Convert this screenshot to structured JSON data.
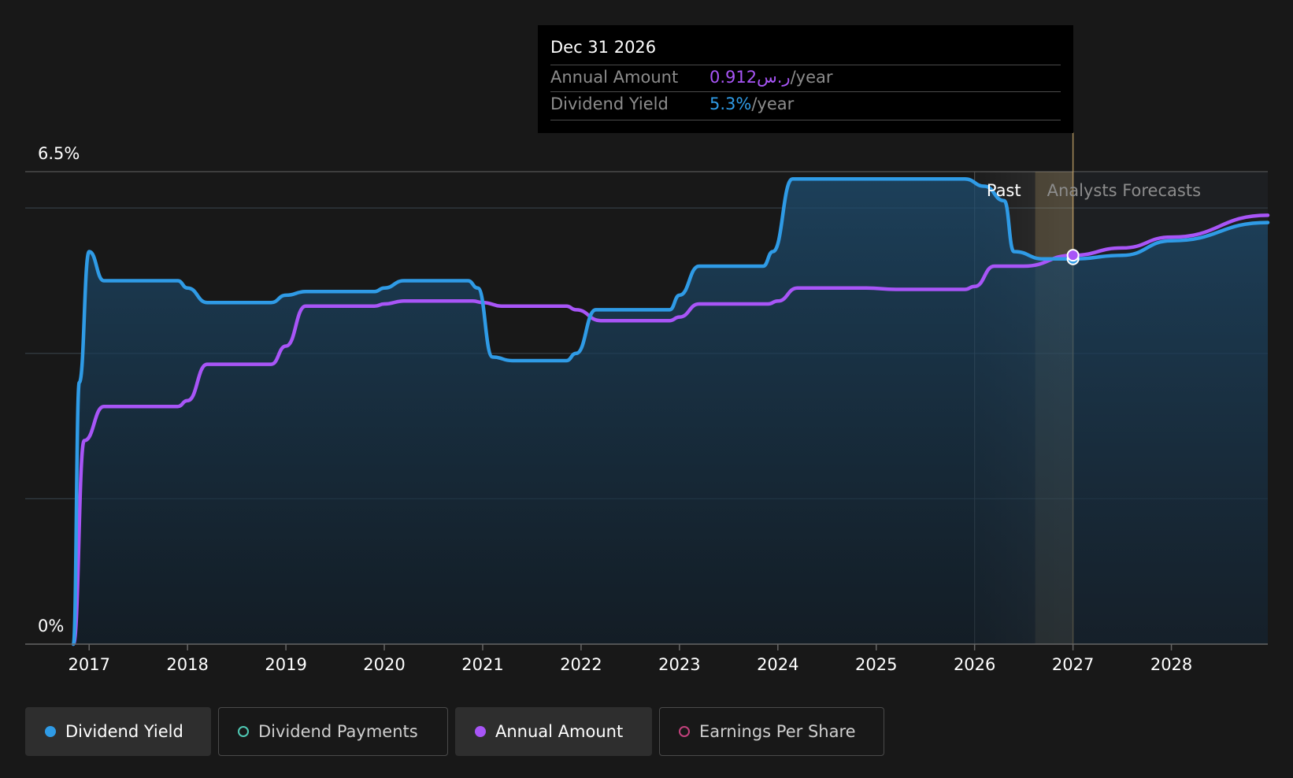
{
  "colors": {
    "dividend_yield": "#2f9be6",
    "dividend_payments": "#4fc9b4",
    "annual_amount": "#a855f7",
    "earnings_per_share": "#c2417c",
    "background": "#181818",
    "forecast_marker": "#c8a86a"
  },
  "tooltip": {
    "date": "Dec 31 2026",
    "annual_amount_label": "Annual Amount",
    "annual_amount_value": "0.912ر.س",
    "annual_amount_suffix": "/year",
    "dividend_yield_label": "Dividend Yield",
    "dividend_yield_value": "5.3%",
    "dividend_yield_suffix": "/year"
  },
  "legend": [
    {
      "label": "Dividend Yield",
      "active": true,
      "icon": "filled-dot-icon"
    },
    {
      "label": "Dividend Payments",
      "active": false,
      "icon": "hollow-dot-icon"
    },
    {
      "label": "Annual Amount",
      "active": true,
      "icon": "filled-dot-icon"
    },
    {
      "label": "Earnings Per Share",
      "active": false,
      "icon": "hollow-dot-icon"
    }
  ],
  "chart_data": {
    "type": "line",
    "ylim": [
      0,
      6.5
    ],
    "y_unit": "%",
    "y_tick_labels": [
      "6.5%",
      "0%"
    ],
    "xlim": [
      2016.35,
      2028.98
    ],
    "x_ticks": [
      2017,
      2018,
      2019,
      2020,
      2021,
      2022,
      2023,
      2024,
      2025,
      2026,
      2027,
      2028
    ],
    "x_tick_labels": [
      "2017",
      "2018",
      "2019",
      "2020",
      "2021",
      "2022",
      "2023",
      "2024",
      "2025",
      "2026",
      "2027",
      "2028"
    ],
    "region_labels": {
      "past": "Past",
      "forecast": "Analysts Forecasts"
    },
    "past_start": 2026.0,
    "forecast_start": 2027.0,
    "highlight_date": 2027.0,
    "grid": true,
    "legend_position": "bottom",
    "series": [
      {
        "name": "Dividend Yield",
        "color": "#2f9be6",
        "area": true,
        "points": [
          [
            2016.84,
            0.0
          ],
          [
            2016.9,
            3.6
          ],
          [
            2017.0,
            5.4
          ],
          [
            2017.15,
            5.0
          ],
          [
            2017.5,
            5.0
          ],
          [
            2017.9,
            5.0
          ],
          [
            2018.0,
            4.9
          ],
          [
            2018.2,
            4.7
          ],
          [
            2018.6,
            4.7
          ],
          [
            2018.85,
            4.7
          ],
          [
            2019.0,
            4.8
          ],
          [
            2019.2,
            4.85
          ],
          [
            2019.9,
            4.85
          ],
          [
            2020.0,
            4.9
          ],
          [
            2020.2,
            5.0
          ],
          [
            2020.85,
            5.0
          ],
          [
            2020.95,
            4.9
          ],
          [
            2021.1,
            3.95
          ],
          [
            2021.3,
            3.9
          ],
          [
            2021.85,
            3.9
          ],
          [
            2021.95,
            4.0
          ],
          [
            2022.15,
            4.6
          ],
          [
            2022.9,
            4.6
          ],
          [
            2023.0,
            4.8
          ],
          [
            2023.2,
            5.2
          ],
          [
            2023.85,
            5.2
          ],
          [
            2023.95,
            5.4
          ],
          [
            2024.15,
            6.4
          ],
          [
            2024.9,
            6.4
          ],
          [
            2025.2,
            6.4
          ],
          [
            2025.9,
            6.4
          ],
          [
            2026.1,
            6.3
          ],
          [
            2026.3,
            6.1
          ],
          [
            2026.4,
            5.4
          ],
          [
            2026.7,
            5.3
          ],
          [
            2027.0,
            5.3
          ],
          [
            2027.5,
            5.35
          ],
          [
            2028.0,
            5.55
          ],
          [
            2028.98,
            5.8
          ]
        ]
      },
      {
        "name": "Annual Amount",
        "color": "#a855f7",
        "area": false,
        "points": [
          [
            2016.84,
            0.0
          ],
          [
            2016.95,
            2.8
          ],
          [
            2017.15,
            3.27
          ],
          [
            2017.9,
            3.27
          ],
          [
            2018.0,
            3.35
          ],
          [
            2018.2,
            3.85
          ],
          [
            2018.85,
            3.85
          ],
          [
            2019.0,
            4.1
          ],
          [
            2019.2,
            4.65
          ],
          [
            2019.9,
            4.65
          ],
          [
            2020.0,
            4.68
          ],
          [
            2020.2,
            4.72
          ],
          [
            2020.9,
            4.72
          ],
          [
            2021.0,
            4.7
          ],
          [
            2021.2,
            4.65
          ],
          [
            2021.85,
            4.65
          ],
          [
            2021.95,
            4.6
          ],
          [
            2022.2,
            4.45
          ],
          [
            2022.9,
            4.45
          ],
          [
            2023.0,
            4.5
          ],
          [
            2023.2,
            4.68
          ],
          [
            2023.9,
            4.68
          ],
          [
            2024.0,
            4.72
          ],
          [
            2024.2,
            4.9
          ],
          [
            2024.9,
            4.9
          ],
          [
            2025.2,
            4.88
          ],
          [
            2025.9,
            4.88
          ],
          [
            2026.0,
            4.92
          ],
          [
            2026.2,
            5.2
          ],
          [
            2026.5,
            5.2
          ],
          [
            2027.0,
            5.35
          ],
          [
            2027.5,
            5.45
          ],
          [
            2028.0,
            5.6
          ],
          [
            2028.98,
            5.9
          ]
        ]
      }
    ]
  }
}
